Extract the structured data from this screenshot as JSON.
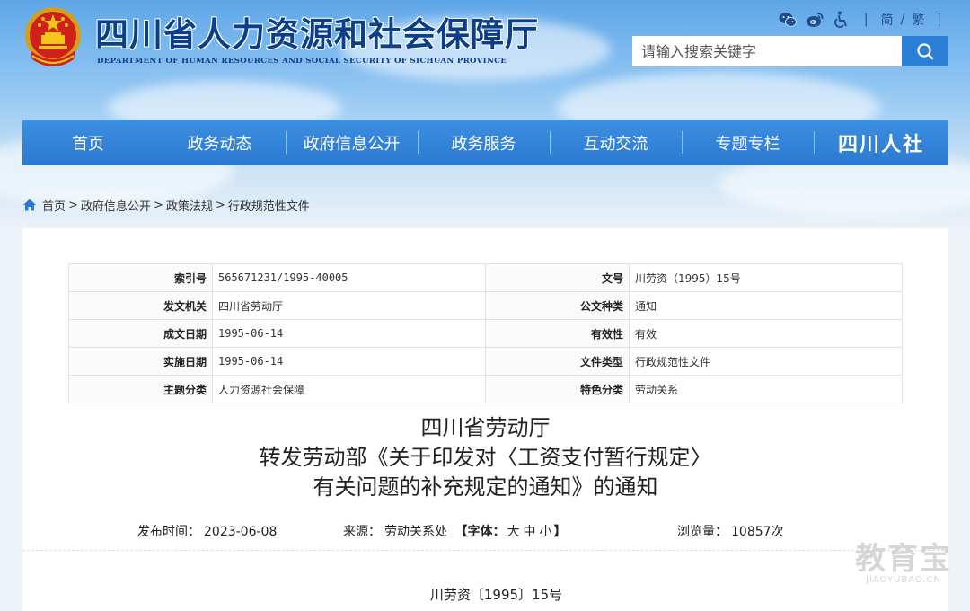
{
  "header": {
    "title": "四川省人力资源和社会保障厅",
    "subtitle": "DEPARTMENT OF HUMAN RESOURCES AND SOCIAL SECURITY OF SICHUAN PROVINCE",
    "tools": {
      "icons": [
        "wechat-icon",
        "weibo-icon",
        "accessibility-icon"
      ],
      "lang_simplified": "简",
      "lang_sep": "/",
      "lang_traditional": "繁",
      "divider": "|"
    },
    "search": {
      "placeholder": "请输入搜索关键字"
    }
  },
  "nav": {
    "items": [
      "首页",
      "政务动态",
      "政府信息公开",
      "政务服务",
      "互动交流",
      "专题专栏"
    ],
    "logo": "四川人社"
  },
  "breadcrumb": [
    "首页",
    "政府信息公开",
    "政策法规",
    "行政规范性文件"
  ],
  "meta": [
    {
      "k1": "索引号",
      "v1": "565671231/1995-40005",
      "k2": "文号",
      "v2": "川劳资（1995）15号"
    },
    {
      "k1": "发文机关",
      "v1": "四川省劳动厅",
      "k2": "公文种类",
      "v2": "通知"
    },
    {
      "k1": "成文日期",
      "v1": "1995-06-14",
      "k2": "有效性",
      "v2": "有效"
    },
    {
      "k1": "实施日期",
      "v1": "1995-06-14",
      "k2": "文件类型",
      "v2": "行政规范性文件"
    },
    {
      "k1": "主题分类",
      "v1": "人力资源社会保障",
      "k2": "特色分类",
      "v2": "劳动关系"
    }
  ],
  "doc": {
    "title_lines": [
      "四川省劳动厅",
      "转发劳动部《关于印发对〈工资支付暂行规定〉",
      "有关问题的补充规定的通知》的通知"
    ],
    "publish_label": "发布时间：",
    "publish_date": "2023-06-08",
    "source_label": "来源：",
    "source": "劳动关系处",
    "font_label_open": "【字体：",
    "font_large": "大",
    "font_medium": "中",
    "font_small": "小",
    "font_label_close": "】",
    "views_label": "浏览量：",
    "views": "10857次",
    "doc_number": "川劳资〔1995〕15号"
  },
  "watermark": {
    "cn": "教育宝",
    "en": "JIAOYUBAO.CN"
  }
}
